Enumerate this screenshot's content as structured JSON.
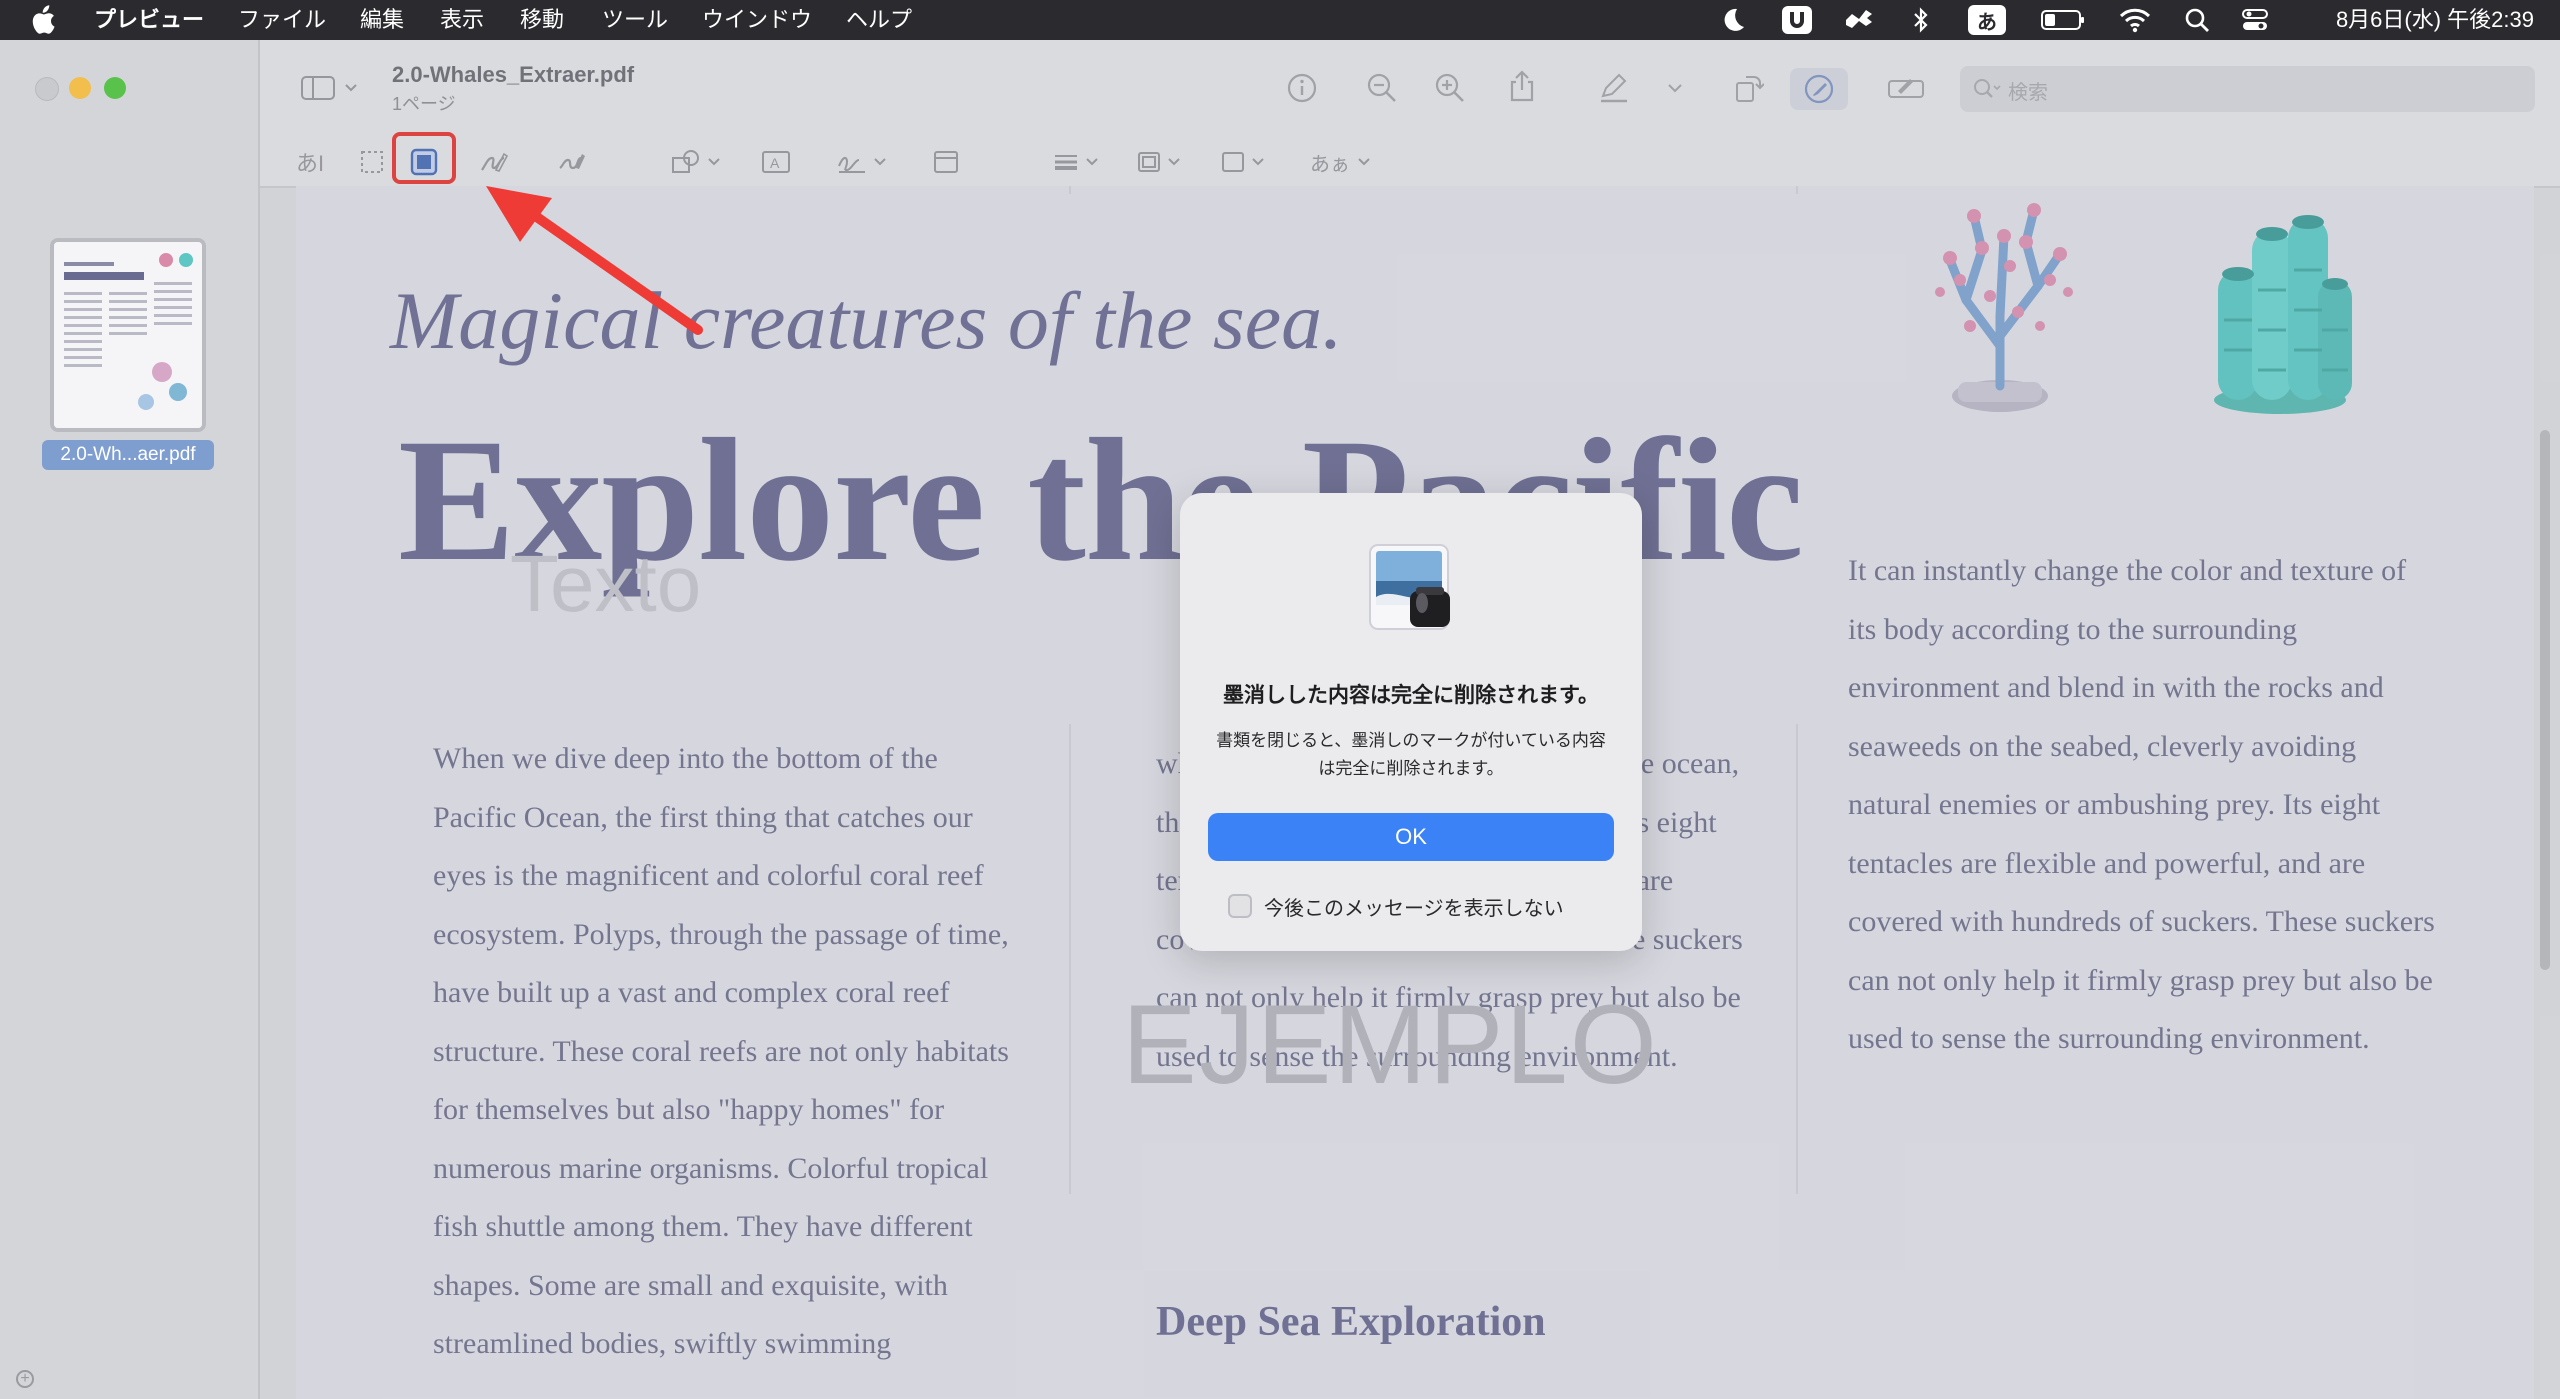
{
  "menubar": {
    "app_name": "プレビュー",
    "items": [
      "ファイル",
      "編集",
      "表示",
      "移動",
      "ツール",
      "ウインドウ",
      "ヘルプ"
    ],
    "input_mode": "あ",
    "datetime": "8月6日(水) 午後2:39"
  },
  "document": {
    "filename": "2.0-Whales_Extraer.pdf",
    "pages": "1ページ",
    "thumbnail_label": "2.0-Wh...aer.pdf"
  },
  "toolbar": {
    "search_placeholder": "検索",
    "text_style_label": "あぁ",
    "sign_label": "あI"
  },
  "page": {
    "headline_italic": "Magical creatures of the sea.",
    "headline_big": "Explore the Pacific",
    "watermark_texto": "Texto",
    "watermark_ejemplo": "EJEMPLO",
    "col1": "When we dive deep into the bottom of the Pacific Ocean, the first thing that catches our eyes is the magnificent and colorful coral reef ecosystem. Polyps, through the passage of time, have built up a vast and complex coral reef structure. These coral reefs are not only habitats for themselves but also \"happy homes\" for numerous marine organisms. Colorful tropical fish shuttle among them. They have different shapes. Some are small and exquisite, with streamlined bodies, swiftly swimming",
    "col2": "when we dive deep into the bottom of the ocean, there are mysterious animal creatures. Its eight tentacles are flexible and powerful, and are covered with hundreds of suckers. These suckers can not only help it firmly grasp prey but also be used to sense the surrounding environment.",
    "col3": "It can instantly change the color and texture of its body according to the surrounding environment and blend in with the rocks and seaweeds on the seabed, cleverly avoiding natural enemies or ambushing prey. Its eight tentacles are flexible and powerful, and are covered with hundreds of suckers. These suckers can not only help it firmly grasp prey but also be used to sense the surrounding environment.",
    "deep_heading": "Deep Sea Exploration"
  },
  "dialog": {
    "title": "墨消しした内容は完全に削除されます。",
    "message": "書類を閉じると、墨消しのマークが付いている内容は完全に削除されます。",
    "ok_label": "OK",
    "checkbox_label": "今後このメッセージを表示しない"
  },
  "colors": {
    "accent": "#3a82f6",
    "highlight": "#e53935",
    "headline": "#6a6b91"
  }
}
